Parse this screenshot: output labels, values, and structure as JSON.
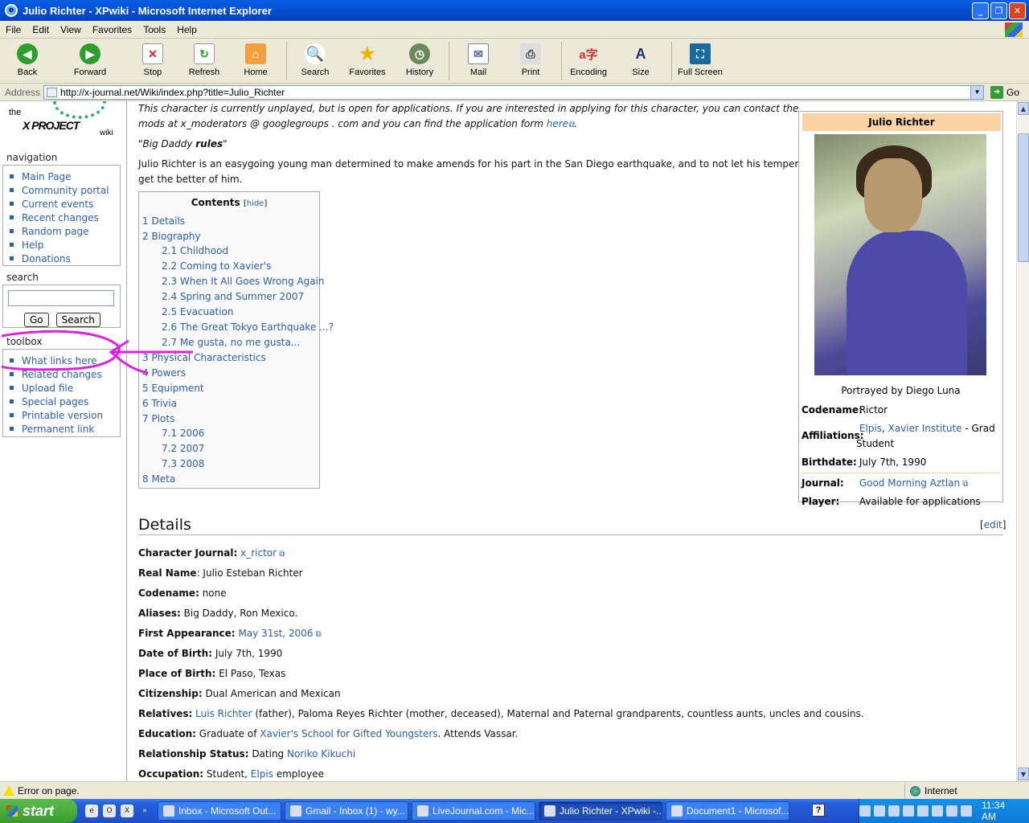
{
  "window": {
    "title": "Julio Richter - XPwiki - Microsoft Internet Explorer"
  },
  "menu": [
    "File",
    "Edit",
    "View",
    "Favorites",
    "Tools",
    "Help"
  ],
  "toolbar": {
    "back": "Back",
    "forward": "Forward",
    "stop": "Stop",
    "refresh": "Refresh",
    "home": "Home",
    "search": "Search",
    "favorites": "Favorites",
    "history": "History",
    "mail": "Mail",
    "print": "Print",
    "encoding": "Encoding",
    "size": "Size",
    "fullscreen": "Full Screen"
  },
  "address": {
    "label": "Address",
    "url": "http://x-journal.net/Wiki/index.php?title=Julio_Richter",
    "go": "Go"
  },
  "logo": {
    "the": "the",
    "name": "X PROJECT",
    "wiki": "wiki"
  },
  "sidebar": {
    "navigation_title": "navigation",
    "navigation": [
      "Main Page",
      "Community portal",
      "Current events",
      "Recent changes",
      "Random page",
      "Help",
      "Donations"
    ],
    "search_title": "search",
    "search_value": "",
    "go": "Go",
    "search_btn": "Search",
    "toolbox_title": "toolbox",
    "toolbox": [
      "What links here",
      "Related changes",
      "Upload file",
      "Special pages",
      "Printable version",
      "Permanent link"
    ]
  },
  "content": {
    "notice1": "This character is currently unplayed, but is open for applications. If you are interested in applying for this character, you can contact the",
    "notice2_pre": "mods at x_moderators @ googlegroups . com and you can find the application form ",
    "notice2_link": "here",
    "notice2_post": ".",
    "quote_pre": "\"Big Daddy ",
    "quote_bold": "rules",
    "quote_post": "\"",
    "intro1": "Julio Richter is an easygoing young man determined to make amends for his part in the San Diego earthquake, and to not let his temper",
    "intro2": "get the better of him.",
    "toc_title": "Contents",
    "toc_hide": "hide",
    "toc": [
      "1 Details",
      "2 Biography",
      "2.1 Childhood",
      "2.2 Coming to Xavier's",
      "2.3 When It All Goes Wrong Again",
      "2.4 Spring and Summer 2007",
      "2.5 Evacuation",
      "2.6 The Great Tokyo Earthquake ...?",
      "2.7 Me gusta, no me gusta...",
      "3 Physical Characteristics",
      "4 Powers",
      "5 Equipment",
      "6 Trivia",
      "7 Plots",
      "7.1 2006",
      "7.2 2007",
      "7.3 2008",
      "8 Meta"
    ],
    "details_heading": "Details",
    "edit": "edit"
  },
  "infobox": {
    "title": "Julio Richter",
    "caption": "Portrayed by Diego Luna",
    "codename_label": "Codename:",
    "codename": "Rictor",
    "affiliations_label": "Affiliations:",
    "aff_link1": "Elpis",
    "aff_sep": ", ",
    "aff_link2": "Xavier Institute",
    "aff_rest1": " - Grad",
    "aff_rest2": "Student",
    "birthdate_label": "Birthdate:",
    "birthdate": "July 7th, 1990",
    "journal_label": "Journal:",
    "journal": "Good Morning Aztlan",
    "player_label": "Player:",
    "player": "Available for applications"
  },
  "details": {
    "journal_label": "Character Journal:",
    "journal": "x_rictor",
    "realname_label": "Real Name",
    "realname": ": Julio Esteban Richter",
    "codename_label": "Codename:",
    "codename": " none",
    "aliases_label": "Aliases:",
    "aliases": " Big Daddy, Ron Mexico.",
    "first_label": "First Appearance:",
    "first": "May 31st, 2006",
    "dob_label": "Date of Birth:",
    "dob": " July 7th, 1990",
    "pob_label": "Place of Birth:",
    "pob": " El Paso, Texas",
    "cit_label": "Citizenship:",
    "cit": " Dual American and Mexican",
    "rel_label": "Relatives:",
    "rel_link": "Luis Richter",
    "rel_rest": " (father), Paloma Reyes Richter (mother, deceased), Maternal and Paternal grandparents, countless aunts, uncles and cousins.",
    "edu_label": "Education:",
    "edu_pre": " Graduate of ",
    "edu_link": "Xavier's School for Gifted Youngsters",
    "edu_post": ". Attends Vassar.",
    "relstat_label": "Relationship Status:",
    "relstat_pre": " Dating ",
    "relstat_link": "Noriko Kikuchi",
    "occ_label": "Occupation:",
    "occ_pre": " Student, ",
    "occ_link": "Elpis",
    "occ_post": " employee"
  },
  "status": {
    "text": "Error on page.",
    "zone": "Internet"
  },
  "taskbar": {
    "start": "start",
    "tasks": [
      "Inbox - Microsoft Out...",
      "Gmail - Inbox (1) - wy...",
      "LiveJournal.com - Mic...",
      "Julio Richter - XPwiki -...",
      "Document1 - Microsof..."
    ],
    "clock": "11:34 AM"
  },
  "colors": {
    "link": "#2a5db0",
    "infobox_header": "#fcd4a4",
    "annotation": "#e020e0"
  }
}
